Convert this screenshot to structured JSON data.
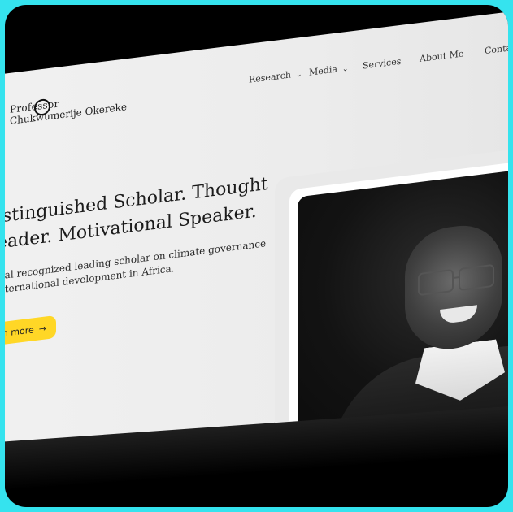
{
  "brand": {
    "line1": "Professor",
    "line2": "Chukwumerije Okereke"
  },
  "nav": {
    "items": [
      {
        "label": "Research",
        "dropdown": true
      },
      {
        "label": "Media",
        "dropdown": true
      },
      {
        "label": "Services",
        "dropdown": false
      },
      {
        "label": "About Me",
        "dropdown": false
      },
      {
        "label": "Conta",
        "dropdown": false
      }
    ]
  },
  "hero": {
    "title_line1": "istinguished Scholar. Thought",
    "title_line2": "eader. Motivational Speaker.",
    "subtitle_line1": "bal recognized leading scholar on climate governance",
    "subtitle_line2": "nternational development in Africa.",
    "cta_label": "n more",
    "cta_icon": "arrow-right-icon"
  },
  "colors": {
    "accent": "#ffd726",
    "frame": "#35e3ee"
  }
}
